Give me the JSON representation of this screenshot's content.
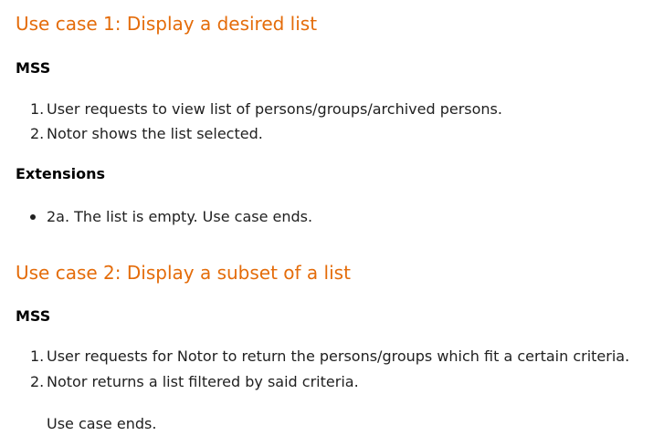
{
  "use_case_1": {
    "heading": "Use case 1: Display a desired list",
    "mss_label": "MSS",
    "steps": [
      {
        "num": "1.",
        "text": "User requests to view list of persons/groups/archived persons."
      },
      {
        "num": "2.",
        "text": "Notor shows the list selected."
      }
    ],
    "extensions_label": "Extensions",
    "extensions": [
      {
        "text": "2a. The list is empty. Use case ends."
      }
    ]
  },
  "use_case_2": {
    "heading": "Use case 2: Display a subset of a list",
    "mss_label": "MSS",
    "steps": [
      {
        "num": "1.",
        "text": "User requests for Notor to return the persons/groups which fit a certain criteria."
      },
      {
        "num": "2.",
        "text": "Notor returns a list filtered by said criteria."
      }
    ],
    "ending": "Use case ends."
  },
  "colors": {
    "heading": "#e46c0a",
    "text": "#212121"
  }
}
